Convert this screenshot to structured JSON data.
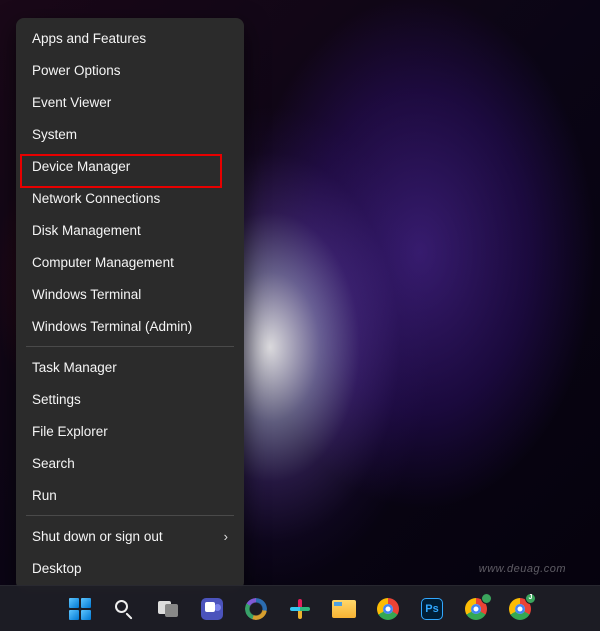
{
  "menu": {
    "items": [
      {
        "label": "Apps and Features",
        "submenu": false
      },
      {
        "label": "Power Options",
        "submenu": false
      },
      {
        "label": "Event Viewer",
        "submenu": false
      },
      {
        "label": "System",
        "submenu": false
      },
      {
        "label": "Device Manager",
        "submenu": false,
        "highlighted": true
      },
      {
        "label": "Network Connections",
        "submenu": false
      },
      {
        "label": "Disk Management",
        "submenu": false
      },
      {
        "label": "Computer Management",
        "submenu": false
      },
      {
        "label": "Windows Terminal",
        "submenu": false
      },
      {
        "label": "Windows Terminal (Admin)",
        "submenu": false
      }
    ],
    "items2": [
      {
        "label": "Task Manager",
        "submenu": false
      },
      {
        "label": "Settings",
        "submenu": false
      },
      {
        "label": "File Explorer",
        "submenu": false
      },
      {
        "label": "Search",
        "submenu": false
      },
      {
        "label": "Run",
        "submenu": false
      }
    ],
    "items3": [
      {
        "label": "Shut down or sign out",
        "submenu": true
      },
      {
        "label": "Desktop",
        "submenu": false
      }
    ]
  },
  "taskbar": {
    "icons": [
      "start",
      "search",
      "task-view",
      "teams",
      "circle-app",
      "slack",
      "file-explorer",
      "chrome",
      "photoshop",
      "chrome-profile-1",
      "chrome-profile-2"
    ]
  },
  "watermark": "www.deuag.com"
}
